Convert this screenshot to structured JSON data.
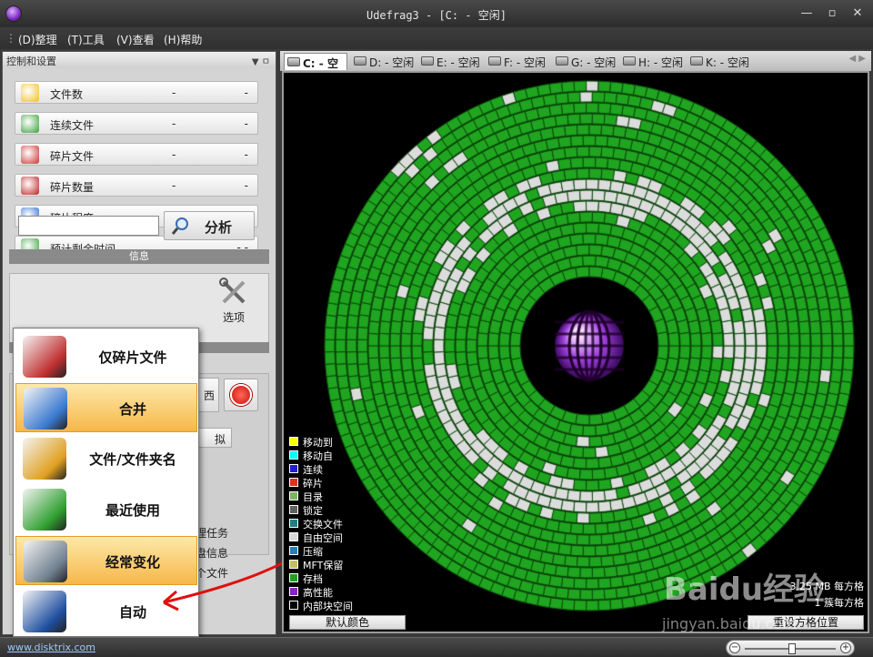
{
  "window": {
    "title": "Udefrag3 - [C: - 空闲]"
  },
  "menu": [
    "(D)整理",
    "(T)工具",
    "(V)查看",
    "(H)帮助"
  ],
  "panel": {
    "title": "控制和设置",
    "stats": [
      {
        "label": "文件数",
        "v1": "-",
        "v2": "-",
        "icon": "files-icon",
        "color": "#f0c020"
      },
      {
        "label": "连续文件",
        "v1": "-",
        "v2": "-",
        "icon": "contiguous-files-icon",
        "color": "#3aa03a"
      },
      {
        "label": "碎片文件",
        "v1": "-",
        "v2": "-",
        "icon": "fragmented-files-icon",
        "color": "#d03030"
      },
      {
        "label": "碎片数量",
        "v1": "-",
        "v2": "-",
        "icon": "fragment-count-icon",
        "color": "#c02020"
      },
      {
        "label": "碎片程度",
        "v1": "-",
        "v2": "-",
        "icon": "fragmentation-level-icon",
        "color": "#2a6ad0"
      },
      {
        "label": "预计剩余时间",
        "v1": "",
        "v2": "- -",
        "icon": "time-remaining-icon",
        "color": "#3aa03a"
      }
    ],
    "analyze_label": "分析",
    "info_label": "信息",
    "options_label": "选项",
    "side_fragments": [
      "理任务",
      "盘信息",
      "个文件"
    ],
    "small_btn": "拟",
    "bg_btn": "西"
  },
  "popup": {
    "items": [
      {
        "label": "仅碎片文件",
        "icon": "fragmented-only-icon",
        "highlight": false
      },
      {
        "label": "合并",
        "icon": "consolidate-icon",
        "highlight": true
      },
      {
        "label": "文件/文件夹名",
        "icon": "file-folder-name-icon",
        "highlight": false
      },
      {
        "label": "最近使用",
        "icon": "recently-used-icon",
        "highlight": false
      },
      {
        "label": "经常变化",
        "icon": "frequently-changed-icon",
        "highlight": true
      },
      {
        "label": "自动",
        "icon": "auto-icon",
        "highlight": false
      }
    ]
  },
  "tabs": [
    {
      "label": "C: - 空闲",
      "active": true
    },
    {
      "label": "D: - 空闲",
      "active": false
    },
    {
      "label": "E: - 空闲",
      "active": false
    },
    {
      "label": "F: - 空闲",
      "active": false
    },
    {
      "label": "G: - 空闲",
      "active": false
    },
    {
      "label": "H: - 空闲",
      "active": false
    },
    {
      "label": "K: - 空闲",
      "active": false
    }
  ],
  "legend": [
    {
      "label": "移动到",
      "color": "#ffff00"
    },
    {
      "label": "移动自",
      "color": "#00ffff"
    },
    {
      "label": "连续",
      "color": "#2020d0"
    },
    {
      "label": "碎片",
      "color": "#e03020"
    },
    {
      "label": "目录",
      "color": "#80b060"
    },
    {
      "label": "锁定",
      "color": "#606060"
    },
    {
      "label": "交换文件",
      "color": "#208080"
    },
    {
      "label": "自由空间",
      "color": "#d8d8d8"
    },
    {
      "label": "压缩",
      "color": "#2080c0"
    },
    {
      "label": "MFT保留",
      "color": "#c0c060"
    },
    {
      "label": "存档",
      "color": "#20a020"
    },
    {
      "label": "高性能",
      "color": "#9020c0"
    },
    {
      "label": "内部块空间",
      "color": "#000000"
    }
  ],
  "map": {
    "default_colors_label": "默认颜色",
    "reset_label": "重设方格位置",
    "cell_info_1": "3.25 MB 每方格",
    "cell_info_2": "1 簇每方格"
  },
  "status": {
    "url": "www.disktrix.com"
  },
  "watermark": {
    "brand": "Baidu经验",
    "url": "jingyan.baidu.com"
  },
  "colors": {
    "used": "#1fa51f",
    "free": "#dcdcdc",
    "gridline": "#0b4a0b"
  }
}
